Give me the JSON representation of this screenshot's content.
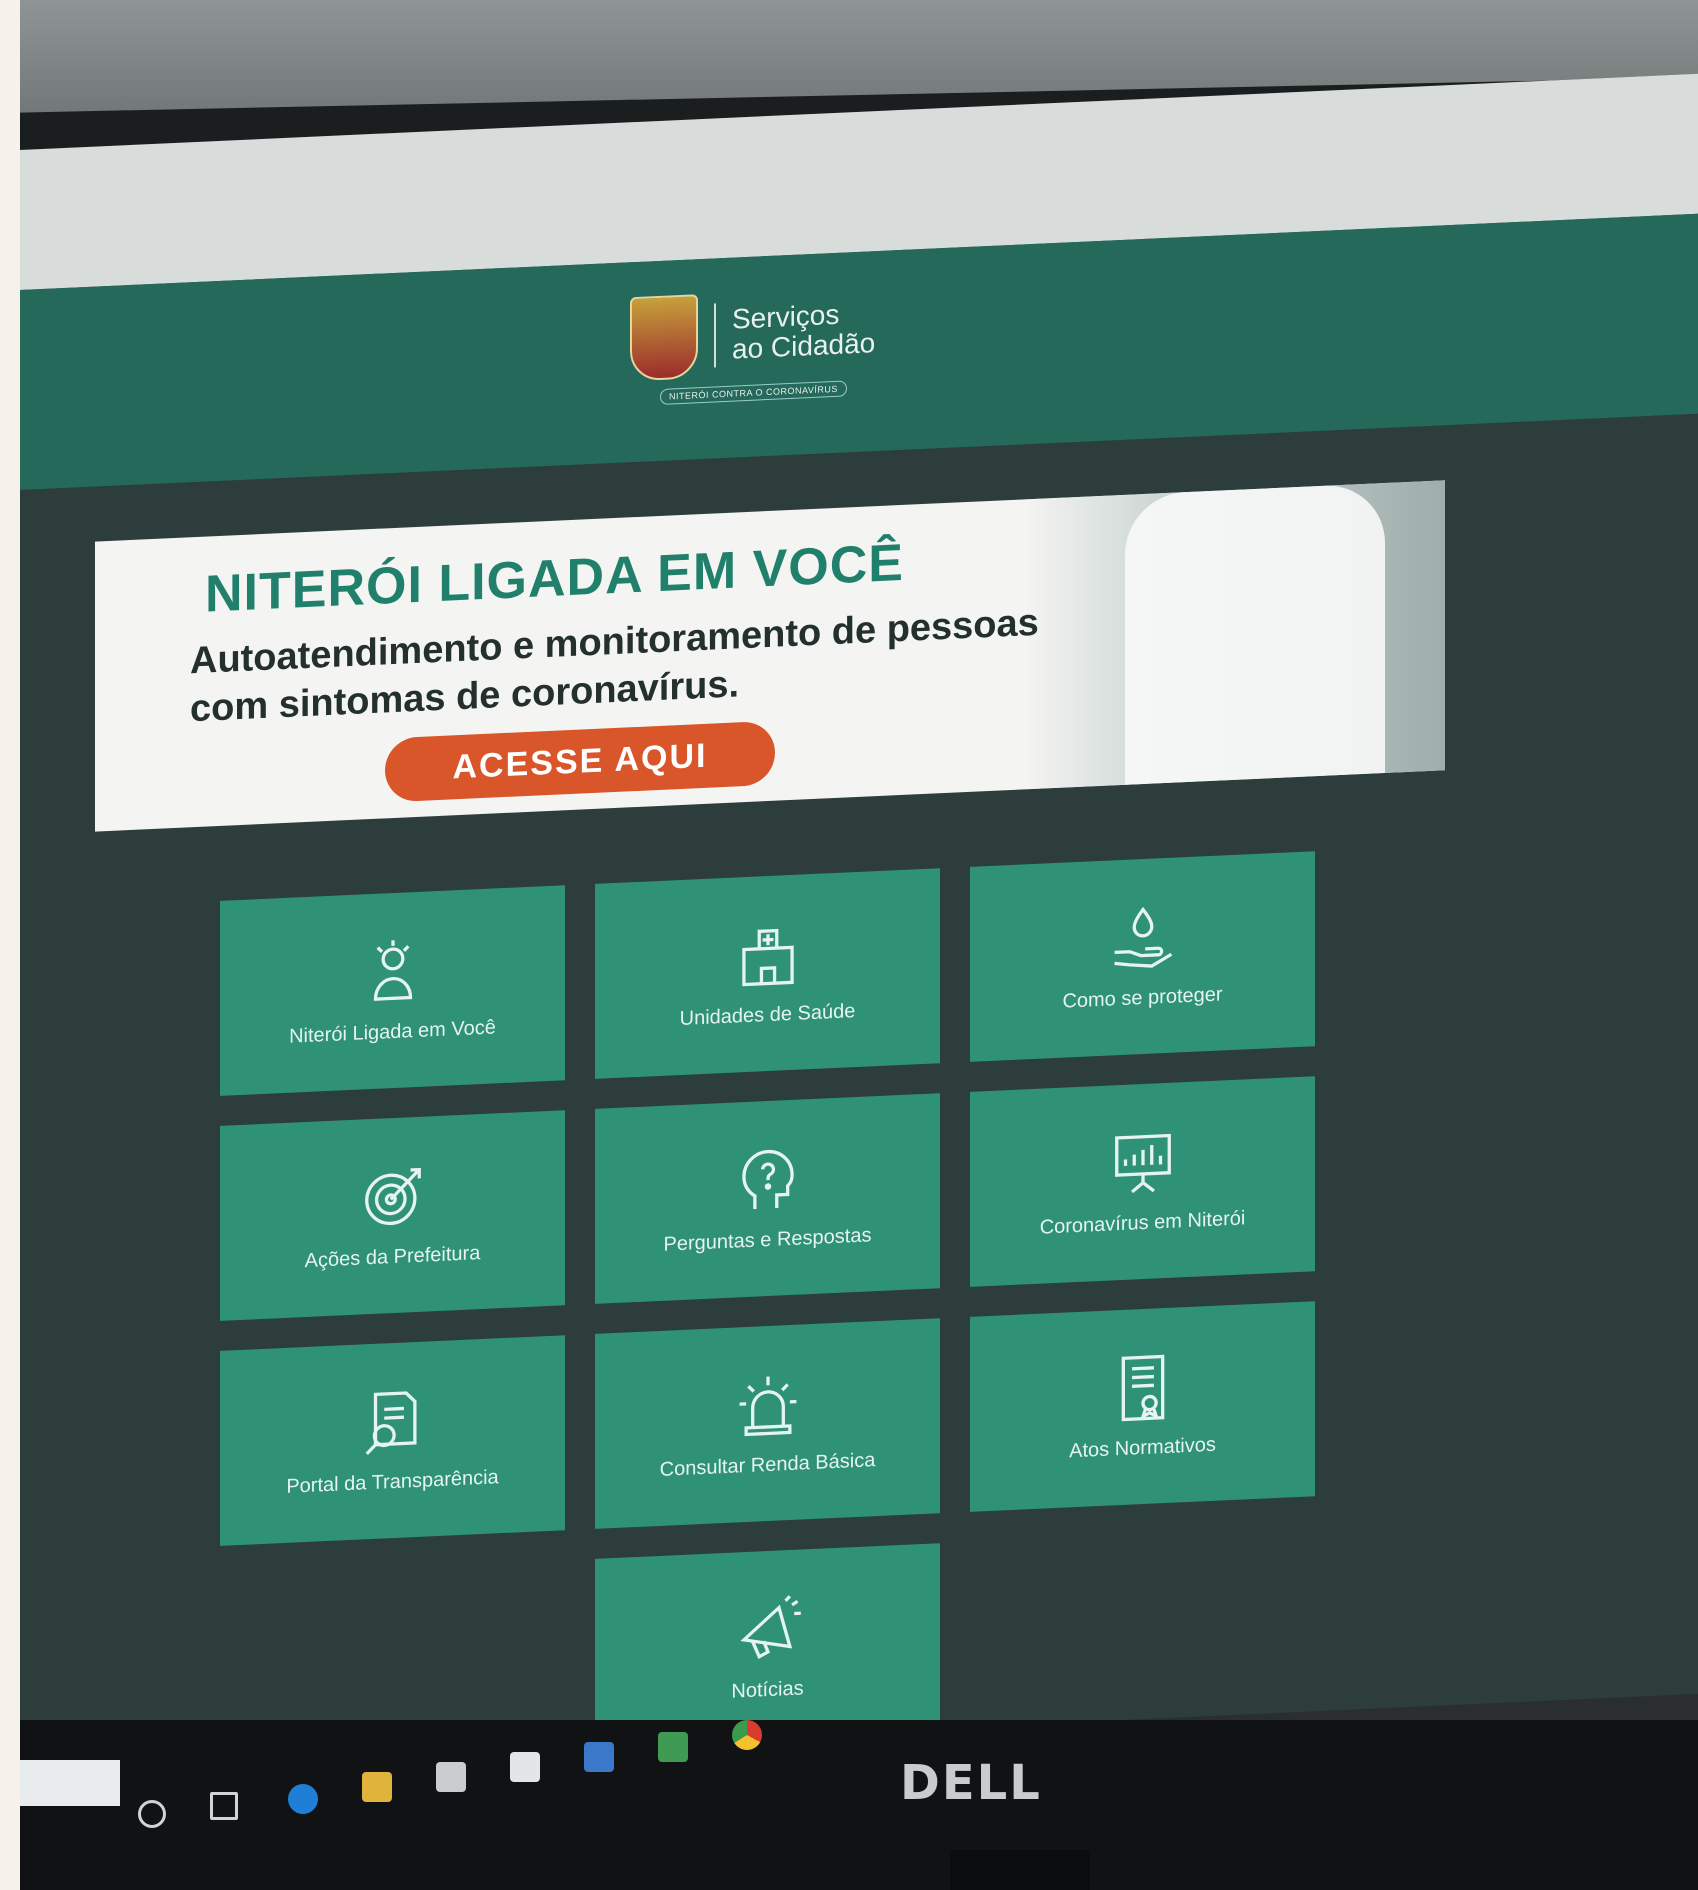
{
  "header": {
    "logo_line1": "Serviços",
    "logo_line2": "ao Cidadão",
    "tagline": "NITERÓI CONTRA O CORONAVÍRUS"
  },
  "banner": {
    "title": "NITERÓI LIGADA EM VOCÊ",
    "subtitle": "Autoatendimento e monitoramento de pessoas com sintomas de coronavírus.",
    "cta": "ACESSE AQUI"
  },
  "tiles": [
    {
      "label": "Niterói Ligada em Você",
      "icon": "person-idea-icon"
    },
    {
      "label": "Unidades de Saúde",
      "icon": "hospital-icon"
    },
    {
      "label": "Como se proteger",
      "icon": "hand-drop-icon"
    },
    {
      "label": "Ações da Prefeitura",
      "icon": "target-icon"
    },
    {
      "label": "Perguntas e Respostas",
      "icon": "question-head-icon"
    },
    {
      "label": "Coronavírus em Niterói",
      "icon": "presentation-chart-icon"
    },
    {
      "label": "Portal da Transparência",
      "icon": "document-search-icon"
    },
    {
      "label": "Consultar Renda Básica",
      "icon": "alarm-light-icon"
    },
    {
      "label": "Atos Normativos",
      "icon": "document-stamp-icon"
    },
    {
      "label": "Notícias",
      "icon": "megaphone-icon"
    }
  ],
  "monitor": {
    "brand": "DELL"
  },
  "taskbar": {
    "icons": [
      "cortana-icon",
      "task-view-icon",
      "edge-icon",
      "file-explorer-icon",
      "store-icon",
      "mail-icon",
      "word-icon",
      "excel-icon",
      "chrome-icon"
    ]
  },
  "colors": {
    "tile": "#2f9277",
    "header": "#24695a",
    "page": "#2c3d3c",
    "banner_title": "#21806b",
    "cta": "#d9562a"
  }
}
